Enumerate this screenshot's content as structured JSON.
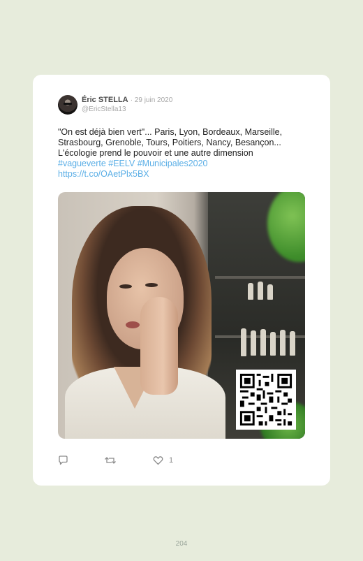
{
  "tweet": {
    "author_name": "Éric STELLA",
    "date": "· 29 juin 2020",
    "handle": "@EricStella13",
    "text_lines": [
      "\"On est déjà bien vert\"... Paris, Lyon, Bordeaux, Marseille,",
      "Strasbourg, Grenoble, Tours, Poitiers, Nancy, Besançon...",
      "L'écologie prend le pouvoir et une autre dimension"
    ],
    "hashtags": "#vagueverte #EELV #Municipales2020",
    "link": "https://t.co/OAetPlx5BX",
    "media": {
      "description_icon": "video-thumbnail",
      "overlay": "qr-code"
    },
    "actions": {
      "reply_icon": "reply-icon",
      "retweet_icon": "retweet-icon",
      "like_icon": "heart-icon",
      "like_count": "1"
    }
  },
  "page": {
    "number": "204"
  },
  "colors": {
    "background": "#e7ecdc",
    "card": "#ffffff",
    "link": "#5aaee6",
    "muted": "#a7a7a7"
  }
}
